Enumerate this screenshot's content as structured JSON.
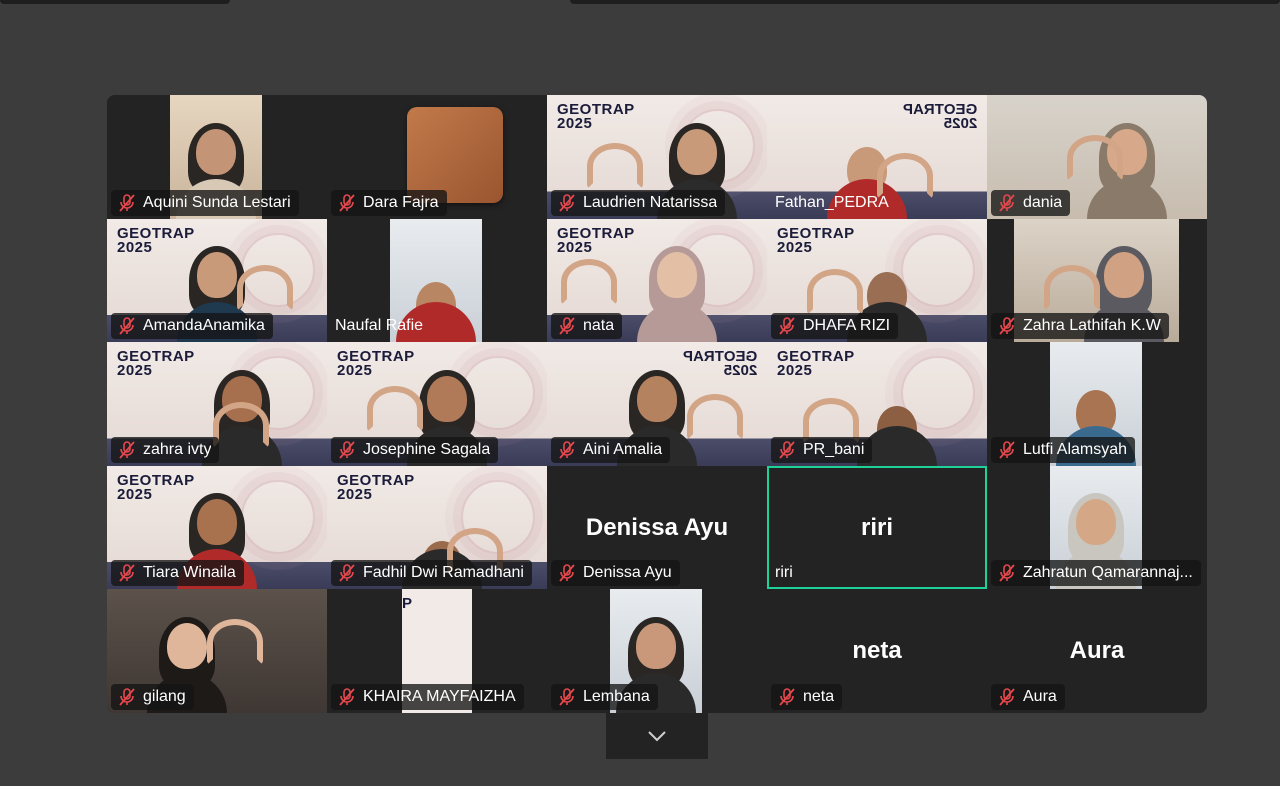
{
  "participants": [
    {
      "name": "Aquini Sunda Lestari",
      "muted": true
    },
    {
      "name": "Dara Fajra",
      "muted": true
    },
    {
      "name": "Laudrien Natarissa",
      "muted": true
    },
    {
      "name": "Fathan_PEDRA",
      "muted": false
    },
    {
      "name": "dania",
      "muted": true
    },
    {
      "name": "AmandaAnamika",
      "muted": true
    },
    {
      "name": "Naufal Rafie",
      "muted": false
    },
    {
      "name": "nata",
      "muted": true
    },
    {
      "name": "DHAFA RIZI",
      "muted": true
    },
    {
      "name": "Zahra Lathifah K.W",
      "muted": true
    },
    {
      "name": "zahra ivty",
      "muted": true
    },
    {
      "name": "Josephine Sagala",
      "muted": true
    },
    {
      "name": "Aini Amalia",
      "muted": true
    },
    {
      "name": "PR_bani",
      "muted": true
    },
    {
      "name": "Lutfi Alamsyah",
      "muted": true
    },
    {
      "name": "Tiara Winaila",
      "muted": true
    },
    {
      "name": "Fadhil Dwi Ramadhani",
      "muted": true
    },
    {
      "name": "Denissa Ayu",
      "muted": true,
      "avatar_text": "Denissa Ayu"
    },
    {
      "name": "riri",
      "muted": false,
      "avatar_text": "riri",
      "active_speaker": true
    },
    {
      "name": "Zahratun Qamarannaj...",
      "muted": true
    },
    {
      "name": "gilang",
      "muted": true
    },
    {
      "name": "KHAIRA MAYFAIZHA",
      "muted": true
    },
    {
      "name": "Lembana",
      "muted": true
    },
    {
      "name": "neta",
      "muted": true,
      "avatar_text": "neta"
    },
    {
      "name": "Aura",
      "muted": true,
      "avatar_text": "Aura"
    }
  ],
  "branding": {
    "logo_line1": "GEOTRAP",
    "logo_line2": "2025",
    "logo_partial": "P"
  },
  "colors": {
    "background": "#3c3c3c",
    "tile_background": "#232323",
    "active_speaker_border": "#1dd199",
    "mute_icon": "#e5484d"
  },
  "icons": {
    "mute": "microphone-muted-icon",
    "expand": "chevron-down-icon"
  }
}
